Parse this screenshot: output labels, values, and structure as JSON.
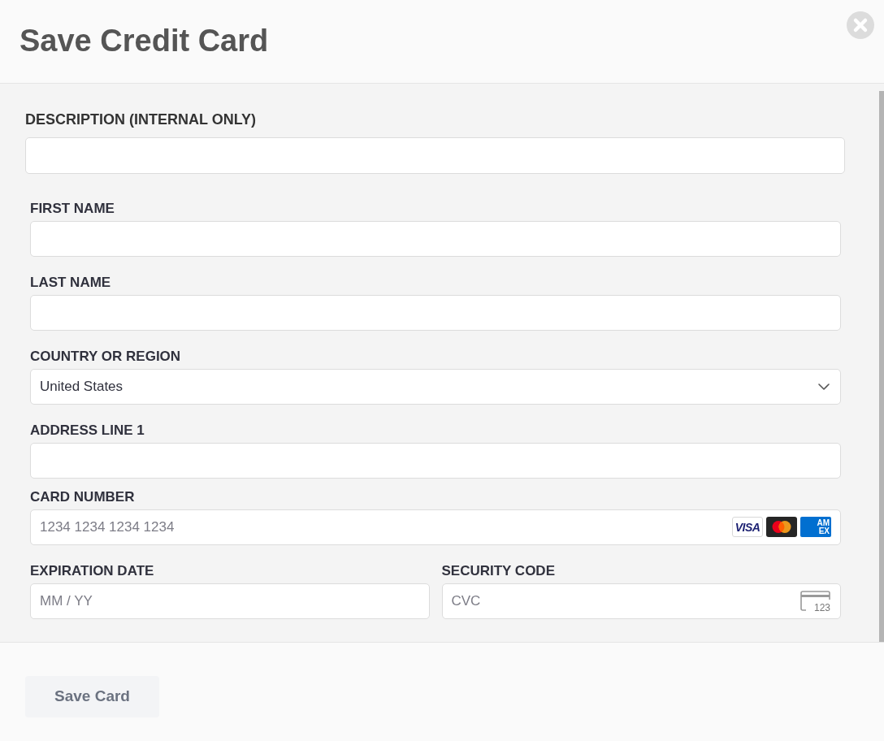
{
  "dialog": {
    "title": "Save Credit Card"
  },
  "description": {
    "label": "DESCRIPTION (INTERNAL ONLY)"
  },
  "fields": [
    {
      "kind": "text",
      "label": "FIRST NAME"
    },
    {
      "kind": "text",
      "label": "LAST NAME"
    },
    {
      "kind": "select",
      "label": "COUNTRY OR REGION",
      "value": "United States"
    },
    {
      "kind": "text",
      "label": "ADDRESS LINE 1"
    },
    {
      "kind": "card_number",
      "label": "CARD NUMBER",
      "placeholder": "1234 1234 1234 1234",
      "brands": [
        {
          "kind": "wordmark",
          "text": "VISA"
        },
        {
          "kind": "circles"
        },
        {
          "kind": "stacked",
          "lines": [
            "AM",
            "EX"
          ]
        }
      ]
    }
  ],
  "field_row": [
    {
      "kind": "text",
      "label": "EXPIRATION DATE",
      "placeholder": "MM / YY"
    },
    {
      "kind": "cvc",
      "label": "SECURITY CODE",
      "placeholder": "CVC",
      "icon_text": "123"
    }
  ],
  "footer": {
    "buttons": [
      "Save Card"
    ]
  }
}
